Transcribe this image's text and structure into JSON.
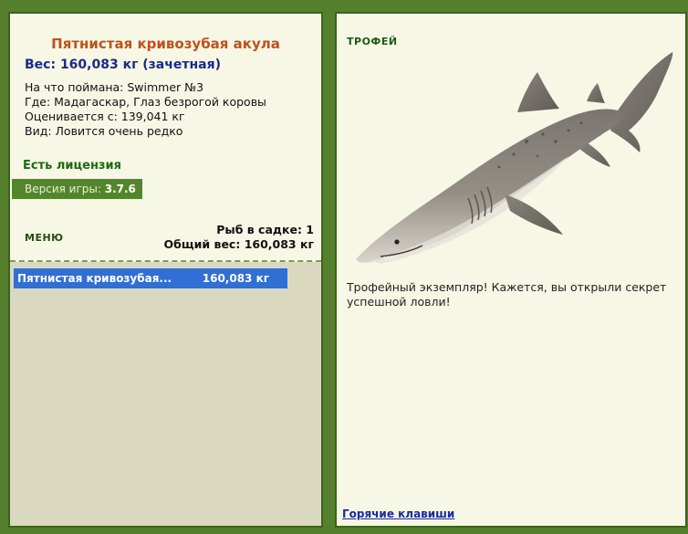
{
  "fish": {
    "title": "Пятнистая кривозубая акула",
    "weight_line": "Вес: 160,083 кг (зачетная)",
    "caught_on": "На что поймана: Swimmer №3",
    "location": "Где: Мадагаскар, Глаз безрогой коровы",
    "rated_from": "Оценивается с: 139,041 кг",
    "kind": "Вид: Ловится очень редко"
  },
  "license": "Есть лицензия",
  "version": {
    "label": "Версия игры:",
    "value": "3.7.6"
  },
  "menu_label": "МЕНЮ",
  "keepnet": {
    "count_line": "Рыб в садке: 1",
    "total_line": "Общий вес: 160,083 кг",
    "rows": [
      {
        "name": "Пятнистая кривозубая...",
        "weight": "160,083 кг"
      }
    ]
  },
  "trophy": {
    "label": "ТРОФЕЙ",
    "text": "Трофейный экземпляр! Кажется, вы открыли секрет успешной ловли!"
  },
  "hotkeys_link": "Горячие клавиши",
  "colors": {
    "frame_green": "#55802e",
    "panel_bg": "#f7f7e6",
    "title_orange": "#c0501a",
    "weight_blue": "#1b2a8a",
    "selection_blue": "#2f6fd6",
    "keepnet_bg": "#dad9c0"
  }
}
